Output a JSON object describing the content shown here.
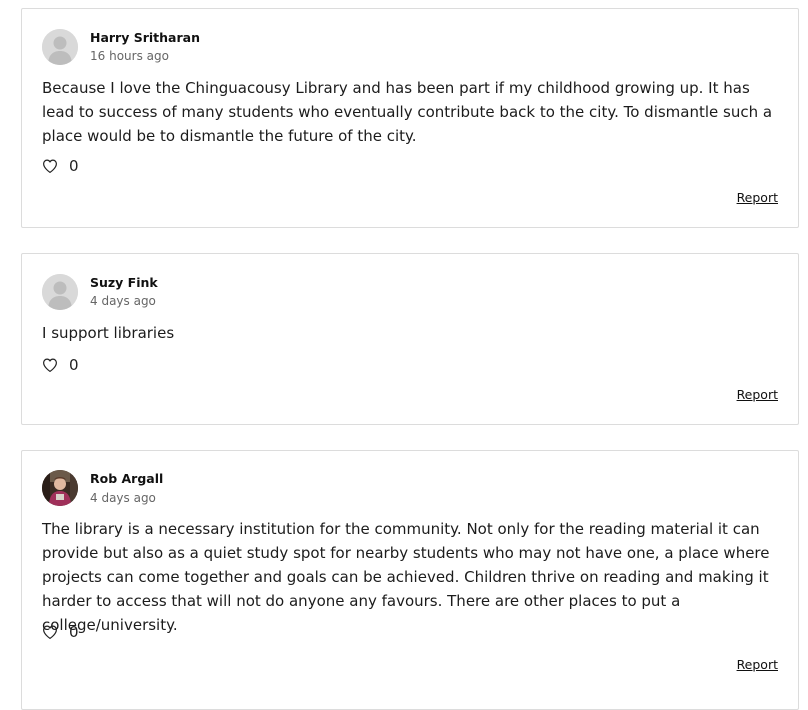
{
  "comments": [
    {
      "author": "Harry Sritharan",
      "time": "16 hours ago",
      "text": "Because I love the Chinguacousy Library and has been part if my childhood growing up. It has lead to success of many students who eventually contribute back to the city. To dismantle such a place would be to dismantle the future of the city.",
      "likes": "0",
      "report_label": "Report",
      "avatar": "default-avatar-icon"
    },
    {
      "author": "Suzy Fink",
      "time": "4 days ago",
      "text": "I support libraries",
      "likes": "0",
      "report_label": "Report",
      "avatar": "default-avatar-icon"
    },
    {
      "author": "Rob Argall",
      "time": "4 days ago",
      "text": "The library is a necessary institution for the community. Not only for the reading material it can provide but also as a quiet study spot for nearby students who may not have one, a place where projects can come together and goals can be achieved. Children thrive on reading and making it harder to access that will not do anyone any favours. There are other places to put a college/university.",
      "likes": "0",
      "report_label": "Report",
      "avatar": "photo-avatar"
    }
  ],
  "colors": {
    "border": "#dcdcdc",
    "avatar_bg": "#d9d9d9",
    "avatar_silhouette": "#bdbdbd",
    "text": "#1c1c1c",
    "muted": "#666666"
  }
}
